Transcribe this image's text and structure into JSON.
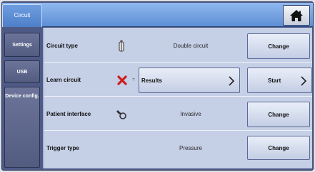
{
  "header": {
    "active_tab": "Circuit",
    "home_icon": "home-icon"
  },
  "sidebar": {
    "items": [
      {
        "label": "Settings"
      },
      {
        "label": "USB"
      },
      {
        "label": "Device config."
      }
    ]
  },
  "rows": [
    {
      "label": "Circuit type",
      "icon": "circuit-tube-icon",
      "value": "Double circuit",
      "button": "Change"
    },
    {
      "label": "Learn circuit",
      "icon": "red-x-icon",
      "separator": "=",
      "results_button": "Results",
      "start_button": "Start"
    },
    {
      "label": "Patient interface",
      "icon": "patient-interface-icon",
      "value": "Invasive",
      "button": "Change"
    },
    {
      "label": "Trigger type",
      "value": "Pressure",
      "button": "Change"
    }
  ],
  "colors": {
    "header": "#6e9de0",
    "frame": "#4e5a86",
    "content_bg": "#c5cfe6",
    "error_x": "#cc1e1e"
  }
}
